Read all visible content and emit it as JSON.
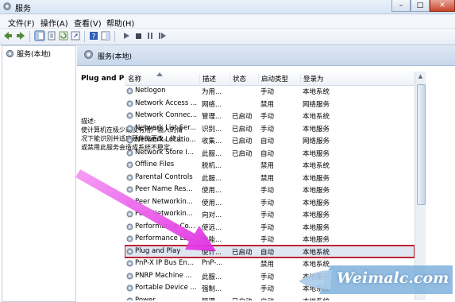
{
  "window": {
    "title": "服务"
  },
  "menu": [
    "文件(F)",
    "操作(A)",
    "查看(V)",
    "帮助(H)"
  ],
  "tree": {
    "root": "服务(本地)"
  },
  "panel": {
    "header": "服务(本地)"
  },
  "details": {
    "service_name": "Plug and Play",
    "description_label": "描述:",
    "description_lines": [
      "使计算机在极少或没有用户输入的情",
      "况下能识别并适应硬件的更改。终止",
      "或禁用此服务会造成系统不稳定。"
    ]
  },
  "table": {
    "columns": [
      "名称",
      "描述",
      "状态",
      "启动类型",
      "登录为"
    ],
    "rows": [
      {
        "name": "Netlogon",
        "desc": "为用...",
        "status": "",
        "startup": "手动",
        "logon": "本地系统"
      },
      {
        "name": "Network Access ...",
        "desc": "网络...",
        "status": "",
        "startup": "禁用",
        "logon": "网络服务"
      },
      {
        "name": "Network Connec...",
        "desc": "管理...",
        "status": "已启动",
        "startup": "手动",
        "logon": "本地系统"
      },
      {
        "name": "Network List Ser...",
        "desc": "识别...",
        "status": "已启动",
        "startup": "手动",
        "logon": "本地服务"
      },
      {
        "name": "Network Locatio...",
        "desc": "收集...",
        "status": "已启动",
        "startup": "自动",
        "logon": "网络服务"
      },
      {
        "name": "Network Store I...",
        "desc": "此服...",
        "status": "已启动",
        "startup": "自动",
        "logon": "本地服务"
      },
      {
        "name": "Offline Files",
        "desc": "脱机...",
        "status": "",
        "startup": "禁用",
        "logon": "本地系统"
      },
      {
        "name": "Parental Controls",
        "desc": "此服...",
        "status": "",
        "startup": "禁用",
        "logon": "本地服务"
      },
      {
        "name": "Peer Name Res...",
        "desc": "使用...",
        "status": "",
        "startup": "手动",
        "logon": "本地服务"
      },
      {
        "name": "Peer Networkin...",
        "desc": "使用...",
        "status": "",
        "startup": "手动",
        "logon": "本地服务"
      },
      {
        "name": "Peer Networkin...",
        "desc": "向对...",
        "status": "",
        "startup": "手动",
        "logon": "本地服务"
      },
      {
        "name": "Performance Co...",
        "desc": "使远...",
        "status": "",
        "startup": "手动",
        "logon": "本地服务"
      },
      {
        "name": "Performance Lo...",
        "desc": "性能...",
        "status": "",
        "startup": "手动",
        "logon": "本地服务"
      },
      {
        "name": "Plug and Play",
        "desc": "使计...",
        "status": "已启动",
        "startup": "自动",
        "logon": "本地系统",
        "highlight": true
      },
      {
        "name": "PnP-X IP Bus En...",
        "desc": "PnP-...",
        "status": "",
        "startup": "禁用",
        "logon": "本地系统"
      },
      {
        "name": "PNRP Machine ...",
        "desc": "此服...",
        "status": "",
        "startup": "手动",
        "logon": "本地服务"
      },
      {
        "name": "Portable Device ...",
        "desc": "强制...",
        "status": "",
        "startup": "手动",
        "logon": "本地系统"
      },
      {
        "name": "Power",
        "desc": "管理...",
        "status": "已启动",
        "startup": "自动",
        "logon": "本地系统"
      }
    ]
  },
  "watermark": {
    "text": "Weimalc.com"
  },
  "colors": {
    "highlight_border": "#c0222f",
    "arrow": "#e63ce6"
  }
}
